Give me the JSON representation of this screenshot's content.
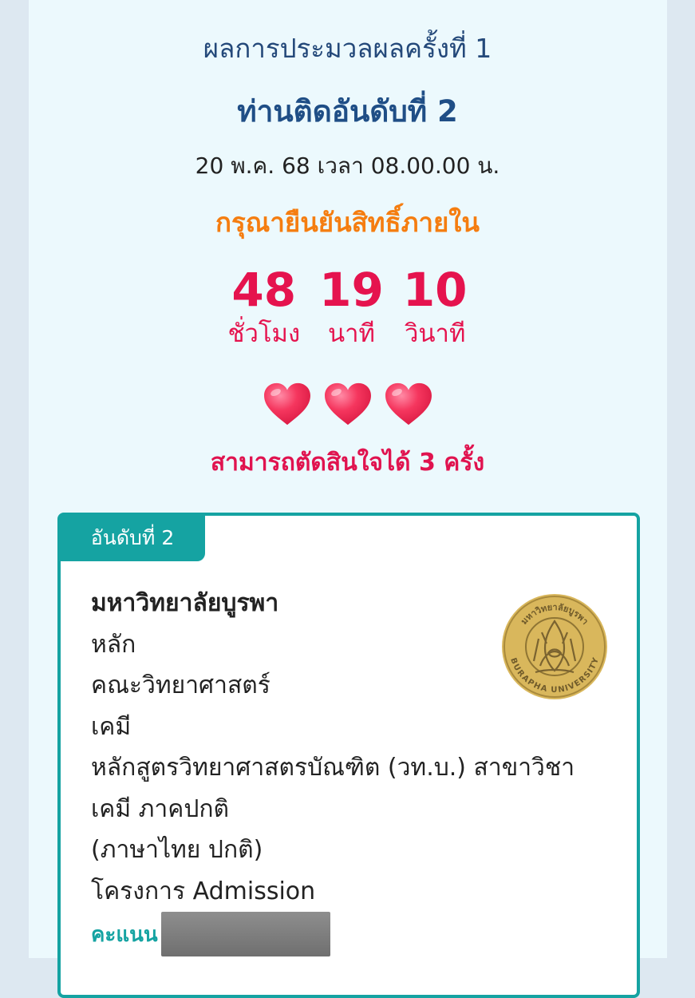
{
  "header": {
    "round_title": "ผลการประมวลผลครั้งที่ 1",
    "rank_title": "ท่านติดอันดับที่ 2",
    "datetime": "20 พ.ค. 68 เวลา 08.00.00 น.",
    "confirm_prompt": "กรุณายืนยันสิทธิ์ภายใน"
  },
  "countdown": {
    "hours": "48",
    "hours_label": "ชั่วโมง",
    "minutes": "19",
    "minutes_label": "นาที",
    "seconds": "10",
    "seconds_label": "วินาที"
  },
  "decisions": {
    "hearts_count": 3,
    "heart_icon": "heart-icon",
    "text": "สามารถตัดสินใจได้ 3 ครั้ง"
  },
  "card": {
    "rank_label": "อันดับที่ 2",
    "university": "มหาวิทยาลัยบูรพา",
    "campus": "หลัก",
    "faculty": "คณะวิทยาศาสตร์",
    "major": "เคมี",
    "program_line1": "หลักสูตรวิทยาศาสตรบัณฑิต (วท.บ.) สาขาวิชา",
    "program_line2": "เคมี ภาคปกติ",
    "language": "(ภาษาไทย ปกติ)",
    "project": "โครงการ Admission",
    "score_label": "คะแนน",
    "seal_icon": "university-seal",
    "seal_text_top": "มหาวิทยาลัยบูรพา",
    "seal_text_bottom": "BURAPHA UNIVERSITY"
  },
  "colors": {
    "navy": "#1f4e86",
    "orange": "#f57d10",
    "pink_red": "#e5134e",
    "teal": "#15a3a2",
    "seal_gold": "#d4b15a",
    "panel_bg": "#ecf9fd"
  }
}
